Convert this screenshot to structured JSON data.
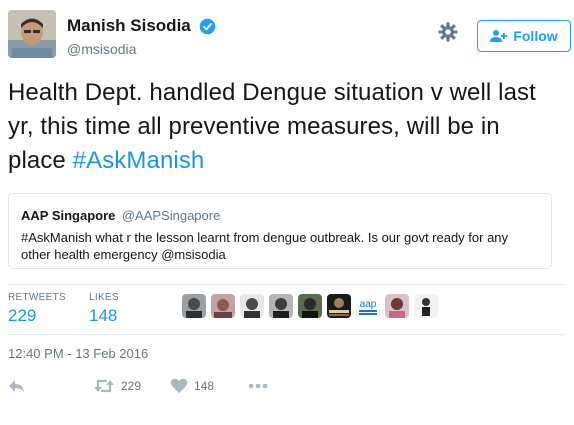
{
  "user": {
    "display_name": "Manish Sisodia",
    "handle": "@msisodia",
    "follow_label": "Follow"
  },
  "tweet": {
    "text": "Health Dept. handled Dengue situation v well last yr, this time all preventive measures, will be in place ",
    "hashtag": "#AskManish"
  },
  "quoted_tweet": {
    "name": "AAP Singapore",
    "handle": "@AAPSingapore",
    "text": "#AskManish what r the lesson learnt from dengue outbreak. Is our govt ready for any other health emergency ",
    "mention": "@msisodia"
  },
  "stats": {
    "retweets_label": "RETWEETS",
    "retweets_value": "229",
    "likes_label": "LIKES",
    "likes_value": "148"
  },
  "likers": [
    {
      "icon": "liker-avatar-1"
    },
    {
      "icon": "liker-avatar-2"
    },
    {
      "icon": "liker-avatar-3"
    },
    {
      "icon": "liker-avatar-4"
    },
    {
      "icon": "liker-avatar-5"
    },
    {
      "icon": "liker-avatar-6"
    },
    {
      "icon": "liker-avatar-7",
      "text": "aap"
    },
    {
      "icon": "liker-avatar-8"
    },
    {
      "icon": "liker-avatar-9"
    }
  ],
  "timestamp": "12:40 PM - 13 Feb 2016",
  "actions": {
    "retweet_count": "229",
    "like_count": "148"
  },
  "colors": {
    "accent": "#1da1f2",
    "link": "#1b95e0",
    "secondary_text": "#657786",
    "border": "#e1e8ed"
  }
}
